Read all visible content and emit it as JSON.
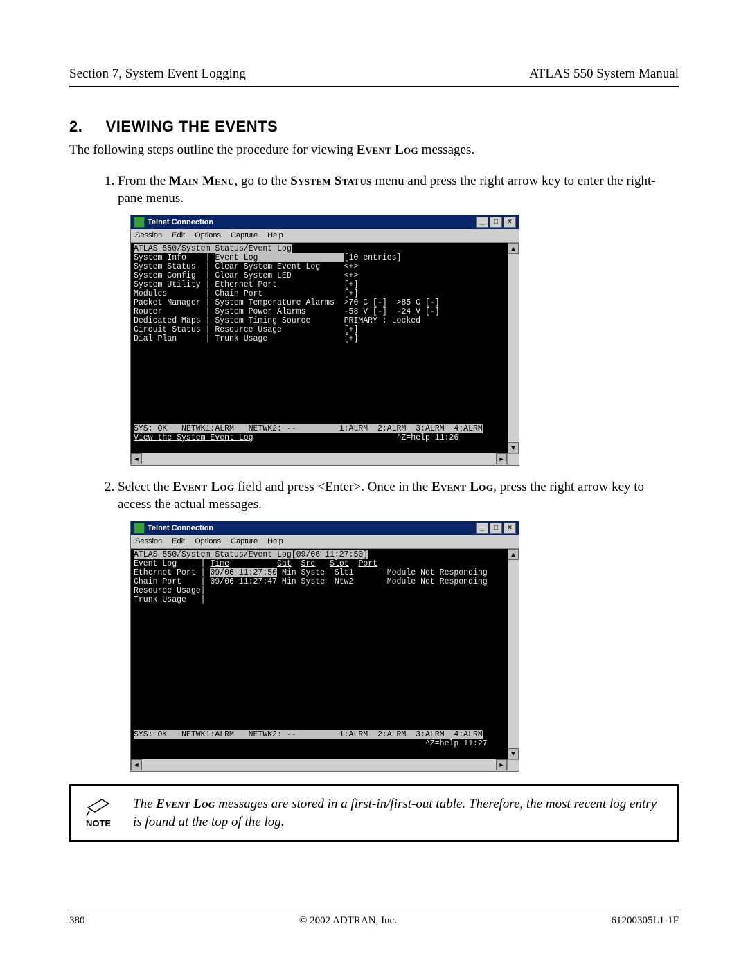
{
  "header": {
    "left": "Section 7, System Event Logging",
    "right": "ATLAS 550 System Manual"
  },
  "section": {
    "number": "2.",
    "title": "VIEWING THE EVENTS"
  },
  "intro_pre": "The following steps outline the procedure for viewing ",
  "intro_sc": "Event Log",
  "intro_post": " messages.",
  "step1": {
    "t1": "From the ",
    "sc1": "Main Menu",
    "t2": ", go to the ",
    "sc2": "System Status",
    "t3": " menu and press the right arrow key to enter the right-pane menus."
  },
  "step2": {
    "t1": "Select the ",
    "sc1": "Event Log",
    "t2": " field and press <Enter>. Once in the ",
    "sc2": "Event Log",
    "t3": ", press the right arrow key to access the actual messages."
  },
  "win_title": "Telnet Connection",
  "win_btn_min": "_",
  "win_btn_max": "□",
  "win_btn_close": "×",
  "menubar": [
    "Session",
    "Edit",
    "Options",
    "Capture",
    "Help"
  ],
  "term1": {
    "path": "ATLAS 550/System Status/Event Log",
    "left_menu": [
      "System Info",
      "System Status",
      "System Config",
      "System Utility",
      "Modules",
      "Packet Manager",
      "Router",
      "Dedicated Maps",
      "Circuit Status",
      "Dial Plan"
    ],
    "mid": [
      "Event Log",
      "Clear System Event Log",
      "Clear System LED",
      "Ethernet Port",
      "Chain Port",
      "System Temperature Alarms",
      "System Power Alarms",
      "System Timing Source",
      "Resource Usage",
      "Trunk Usage"
    ],
    "right": [
      "[10 entries]",
      "<+>",
      "<+>",
      "[+]",
      "[+]",
      ">70 C [-]  >85 C [-]",
      "-58 V [-]  -24 V [-]",
      "PRIMARY : Locked",
      "[+]",
      "[+]"
    ],
    "status": "SYS: OK   NETWK1:ALRM   NETWK2: --         1:ALRM  2:ALRM  3:ALRM  4:ALRM",
    "hint": "View the System Event Log",
    "help": "^Z=help 11:26"
  },
  "term2": {
    "path": "ATLAS 550/System Status/Event Log[09/06 11:27:50]",
    "left_menu": [
      "Event Log",
      "Ethernet Port",
      "Chain Port",
      "Resource Usage",
      "Trunk Usage"
    ],
    "cols": "              Time          Cat  Src   Slot  Port",
    "row1": "              09/06 11:27:50 Min Syste  Slt1       Module Not Responding",
    "row2": "              09/06 11:27:47 Min Syste  Ntw2       Module Not Responding",
    "row1_hi": "09/06 11:27:50",
    "status": "SYS: OK   NETWK1:ALRM   NETWK2: --         1:ALRM  2:ALRM  3:ALRM  4:ALRM",
    "help": "^Z=help 11:27"
  },
  "note": {
    "label": "NOTE",
    "t1": "The ",
    "sc": "Event Log",
    "t2": " messages are stored in a first-in/first-out table. Therefore, the most recent log entry is found at the top of the log."
  },
  "footer": {
    "page": "380",
    "center": "© 2002 ADTRAN, Inc.",
    "right": "61200305L1-1F"
  },
  "scroll": {
    "up": "▲",
    "down": "▼",
    "left": "◄",
    "right": "►"
  }
}
